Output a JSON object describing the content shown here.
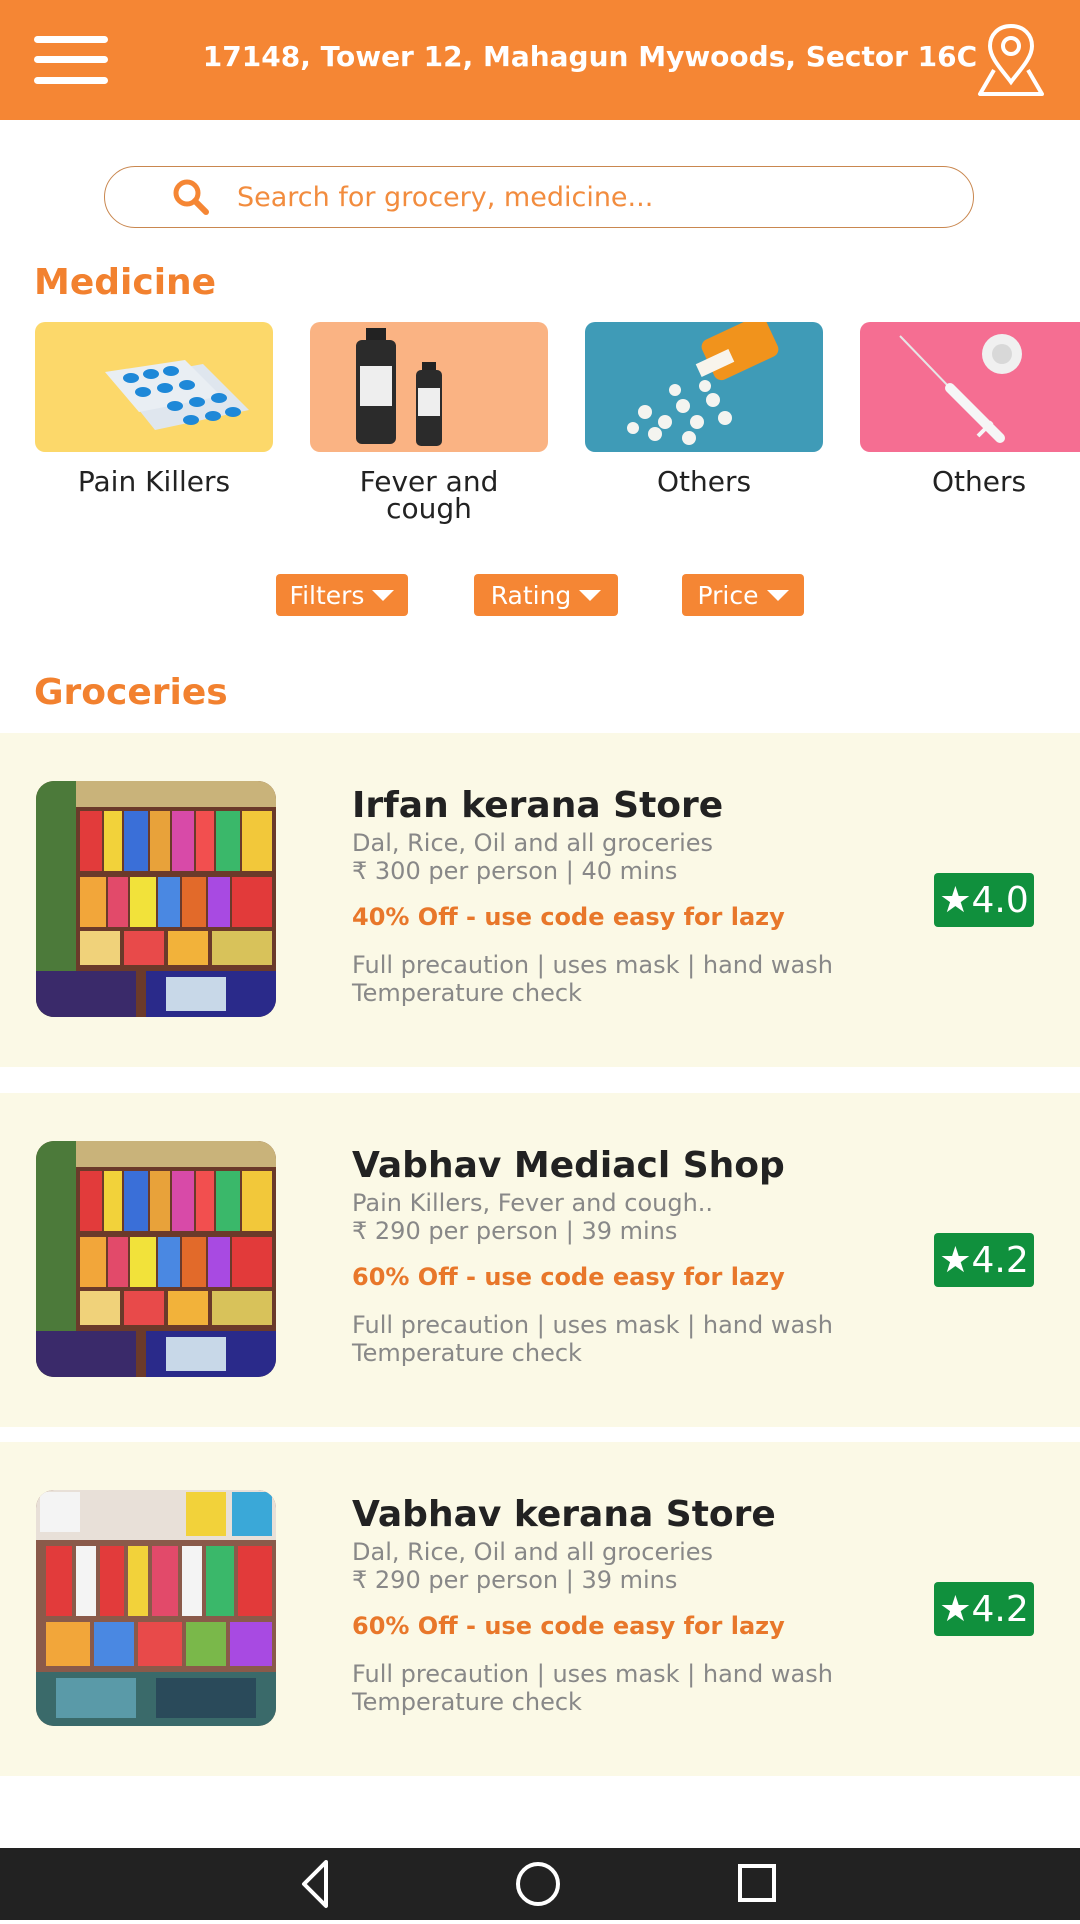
{
  "header": {
    "address": "17148, Tower 12, Mahagun Mywoods, Sector 16C",
    "menu_icon": "hamburger-menu-icon",
    "location_icon": "map-pin-icon"
  },
  "search": {
    "placeholder": "Search for grocery, medicine..."
  },
  "medicine": {
    "title": "Medicine",
    "categories": [
      {
        "label": "Pain Killers"
      },
      {
        "label": "Fever and cough"
      },
      {
        "label": "Others"
      },
      {
        "label": "Others"
      }
    ]
  },
  "filters": [
    {
      "label": "Filters"
    },
    {
      "label": "Rating"
    },
    {
      "label": "Price"
    }
  ],
  "groceries": {
    "title": "Groceries",
    "stores": [
      {
        "name": "Irfan kerana Store",
        "items": "Dal, Rice, Oil and all groceries",
        "price_time": "₹ 300 per person | 40 mins",
        "offer": "40% Off - use code easy for lazy",
        "safety_line1": "Full precaution | uses mask | hand wash",
        "safety_line2": "Temperature check",
        "rating": "★4.0"
      },
      {
        "name": "Vabhav Mediacl Shop",
        "items": "Pain Killers, Fever and cough..",
        "price_time": "₹ 290 per person | 39 mins",
        "offer": "60% Off - use code easy for lazy",
        "safety_line1": "Full precaution | uses mask | hand wash",
        "safety_line2": "Temperature check",
        "rating": "★4.2"
      },
      {
        "name": "Vabhav kerana Store",
        "items": "Dal, Rice, Oil and all groceries",
        "price_time": "₹ 290 per person | 39 mins",
        "offer": "60% Off - use code easy for lazy",
        "safety_line1": "Full precaution | uses mask | hand wash",
        "safety_line2": "Temperature check",
        "rating": "★4.2"
      }
    ]
  },
  "colors": {
    "brand": "#f58634",
    "section_title": "#f2812f",
    "rating_badge": "#10903d",
    "card_bg": "#fbf9e6",
    "nav_bar": "#222222"
  },
  "system_nav": {
    "back_icon": "back-triangle-icon",
    "home_icon": "home-circle-icon",
    "recents_icon": "recents-square-icon"
  }
}
